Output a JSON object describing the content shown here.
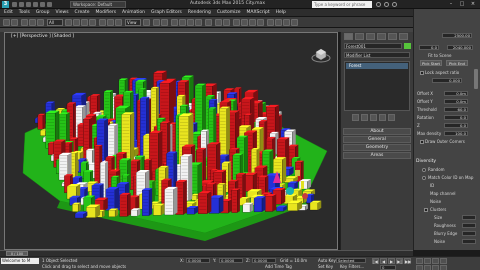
{
  "title_bar": {
    "workspace_label": "Workspace: Default",
    "file_title": "Autodesk 3ds Max 2015    City.max",
    "search_placeholder": "Type a keyword or phrase",
    "logo_icon": "app-logo-icon"
  },
  "menu": [
    "Edit",
    "Tools",
    "Group",
    "Views",
    "Create",
    "Modifiers",
    "Animation",
    "Graph Editors",
    "Rendering",
    "Customize",
    "MAXScript",
    "Help"
  ],
  "toolbar": {
    "filter_dropdown": "All",
    "view_dropdown": "View"
  },
  "viewport": {
    "label": "[+] [Perspective ] [Shaded ]",
    "colors": {
      "red": "#c8161b",
      "green": "#25c417",
      "yellow": "#e9e51f",
      "blue": "#2430d6",
      "white": "#f2f2f2"
    }
  },
  "command_panel": {
    "object_name": "Forest001",
    "object_color": "#56c43b",
    "modifier_list": "Modifier List",
    "stack_item": "Forest",
    "rollouts": [
      "About",
      "General",
      "Geometry",
      "Areas"
    ]
  },
  "right_panel": {
    "top_value": "2500.00",
    "fields_top": [
      {
        "label": "",
        "value": "0.0"
      },
      {
        "label": "",
        "value": "2040.000"
      }
    ],
    "fit_label": "Fit to Scene",
    "pick_start": "Pick Start",
    "pick_end": "Pick End",
    "lock_label": "Lock aspect ratio",
    "lock_value": "0.000",
    "spinners": [
      {
        "label": "Offset X",
        "value": "0.0m"
      },
      {
        "label": "Offset Y",
        "value": "0.0m"
      },
      {
        "label": "Threshold",
        "value": "60.0"
      },
      {
        "label": "Rotation",
        "value": "0.0"
      },
      {
        "label": "Z",
        "value": "0.0"
      },
      {
        "label": "Max density",
        "value": "100.0"
      }
    ],
    "draw_outer": "Draw Outer Corners",
    "diversity_head": "Diversity",
    "random_label": "Random",
    "match_color_label": "Match Color ID on Map",
    "id_label": "ID",
    "map_channel_label": "Map channel",
    "noise_label": "Noise",
    "clusters_label": "Clusters",
    "size_label": "Size",
    "roughness_label": "Roughness",
    "blurry_edge_label": "Blurry Edge",
    "noise2_label": "Noise"
  },
  "timeline": {
    "position": "0 / 100",
    "ticks": [
      "0",
      "10",
      "20",
      "30",
      "40",
      "50",
      "60",
      "70",
      "80",
      "90",
      "100"
    ]
  },
  "status_bar": {
    "maxscript_text": "Welcome to M",
    "selection_text": "1 Object Selected",
    "prompt_text": "Click and drag to select and move objects",
    "x_label": "X:",
    "x_value": "0.0000",
    "y_label": "Y:",
    "y_value": "0.0000",
    "z_label": "Z:",
    "z_value": "0.0000",
    "grid_label": "Grid = 10.0m",
    "add_time_tag": "Add Time Tag",
    "auto_key": "Auto Key",
    "set_key": "Set Key",
    "selected_dropdown": "Selected",
    "key_filters": "Key Filters...",
    "frame_value": "0"
  }
}
